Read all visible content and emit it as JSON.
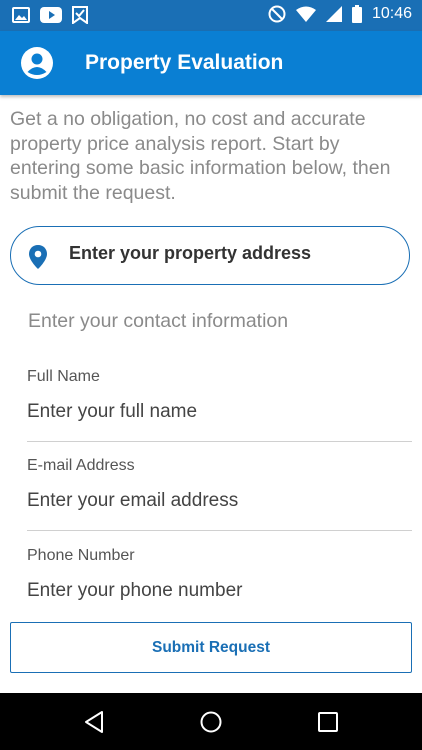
{
  "status_bar": {
    "time": "10:46",
    "icons_left": [
      "gallery-icon",
      "youtube-icon",
      "bookmark-check-icon"
    ],
    "icons_right": [
      "do-not-disturb-icon",
      "wifi-icon",
      "signal-icon",
      "battery-icon"
    ]
  },
  "app_bar": {
    "title": "Property Evaluation",
    "icon": "account-circle-icon"
  },
  "intro_text": "Get a no obligation, no cost and accurate property price analysis report. Start by entering some basic information below, then submit the request.",
  "address": {
    "icon": "location-pin-icon",
    "placeholder": "Enter your property address",
    "value": ""
  },
  "contact": {
    "heading": "Enter your contact information",
    "fields": [
      {
        "label": "Full Name",
        "placeholder": "Enter your full name",
        "value": ""
      },
      {
        "label": "E-mail Address",
        "placeholder": "Enter your email address",
        "value": ""
      },
      {
        "label": "Phone Number",
        "placeholder": "Enter your phone number",
        "value": ""
      }
    ]
  },
  "submit_label": "Submit Request",
  "colors": {
    "primary": "#0a7fd3",
    "status_bar": "#1a6fb5",
    "accent": "#1a6fb5",
    "muted_text": "#8a8a8a"
  },
  "nav_bar": {
    "buttons": [
      "back-icon",
      "home-icon",
      "recents-icon"
    ]
  }
}
